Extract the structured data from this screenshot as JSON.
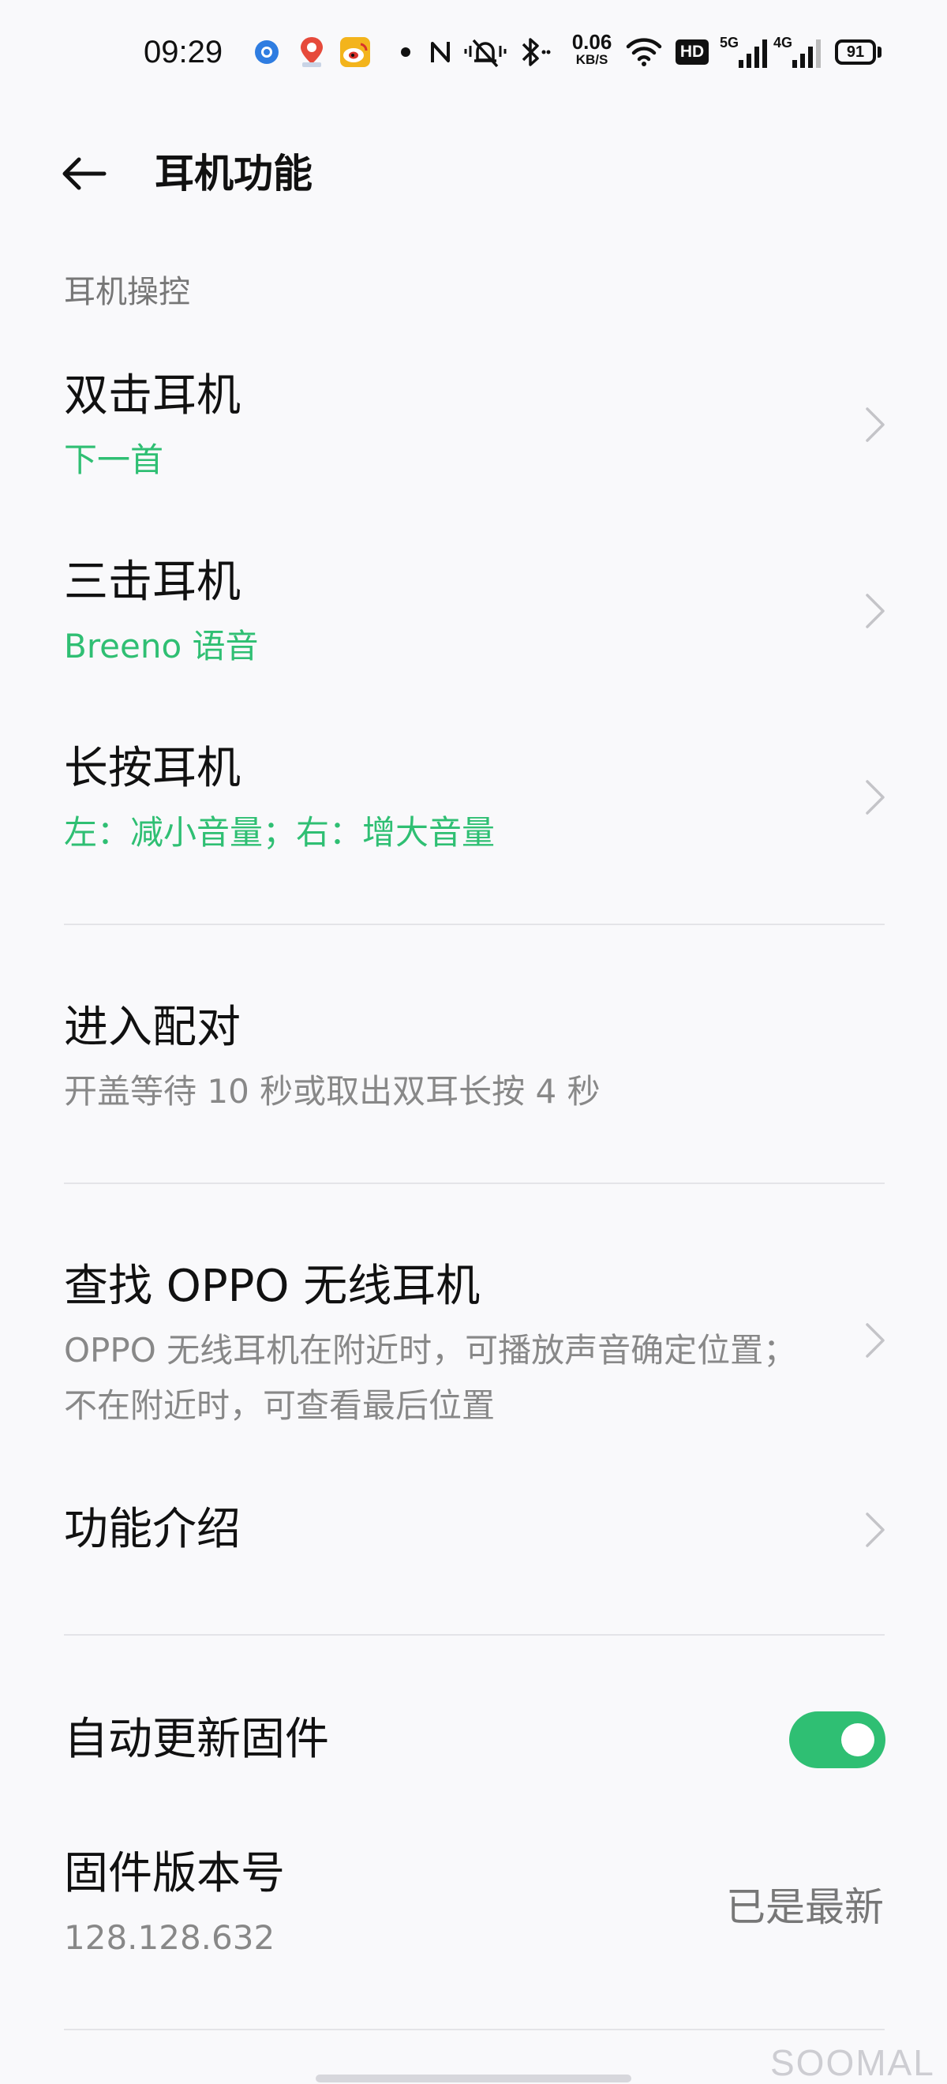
{
  "status_bar": {
    "time": "09:29",
    "net_speed_value": "0.06",
    "net_speed_unit": "KB/S",
    "battery_level": "91",
    "hd_label": "HD",
    "signal_1_label": "5G",
    "signal_2_label": "4G"
  },
  "header": {
    "title": "耳机功能"
  },
  "section": {
    "label": "耳机操控"
  },
  "rows": [
    {
      "title": "双击耳机",
      "subtitle": "下一首"
    },
    {
      "title": "三击耳机",
      "subtitle": "Breeno 语音"
    },
    {
      "title": "长按耳机",
      "subtitle": "左：减小音量；右：增大音量"
    },
    {
      "title": "进入配对",
      "subtitle": "开盖等待 10 秒或取出双耳长按 4 秒"
    },
    {
      "title": "查找 OPPO 无线耳机",
      "subtitle": "OPPO 无线耳机在附近时，可播放声音确定位置；不在附近时，可查看最后位置"
    },
    {
      "title": "功能介绍"
    },
    {
      "title": "自动更新固件",
      "toggle_on": true
    },
    {
      "title": "固件版本号",
      "subtitle": "128.128.632",
      "status": "已是最新"
    }
  ],
  "watermark": "SOOMAL",
  "colors": {
    "accent": "#2fbf73",
    "background": "#f9f9fb",
    "secondary_text": "#888888"
  }
}
